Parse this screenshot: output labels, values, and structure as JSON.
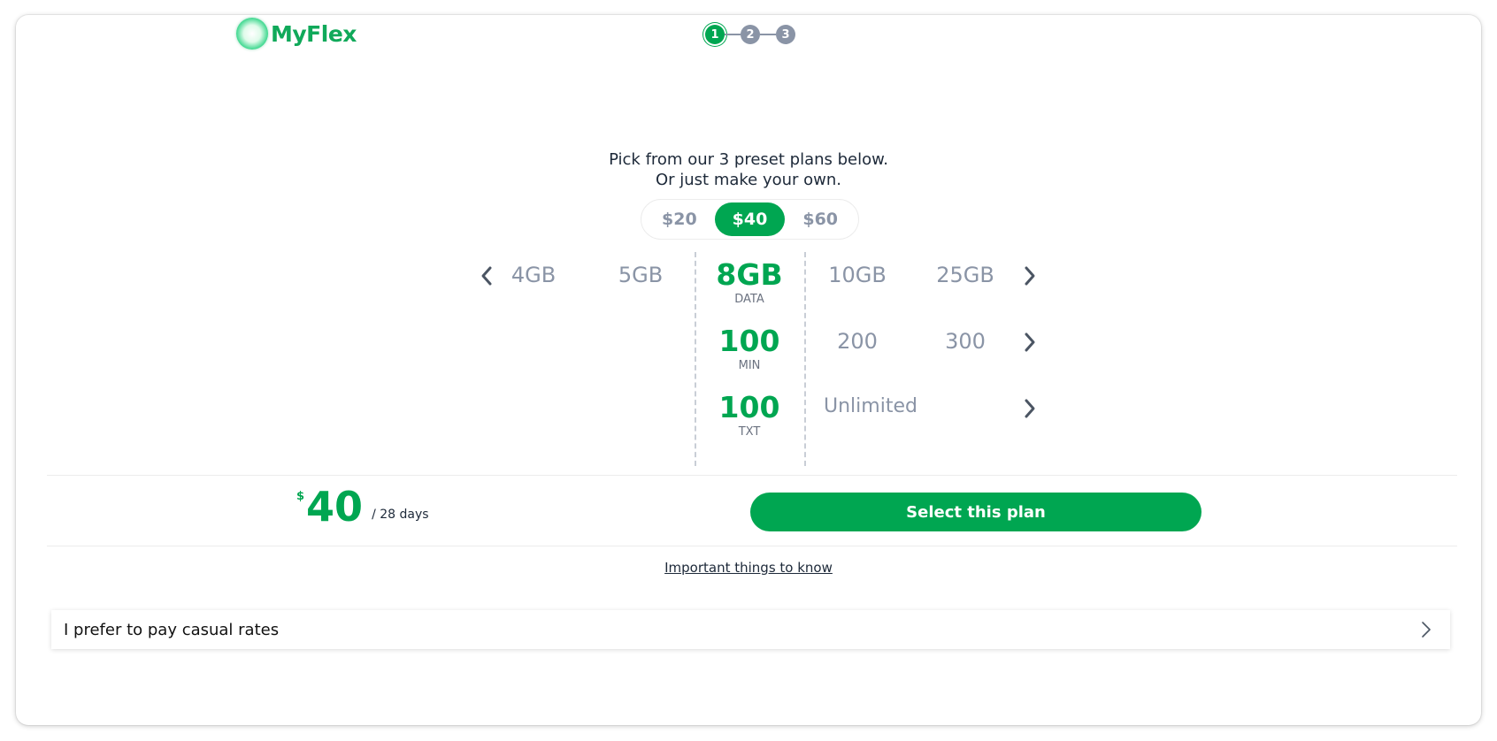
{
  "brand": {
    "name": "MyFlex"
  },
  "stepper": {
    "steps": [
      "1",
      "2",
      "3"
    ],
    "active": 1
  },
  "intro": {
    "line1": "Pick from our 3 preset plans below.",
    "line2": "Or just make your own."
  },
  "price_tabs": [
    {
      "label": "$20",
      "selected": false
    },
    {
      "label": "$40",
      "selected": true
    },
    {
      "label": "$60",
      "selected": false
    }
  ],
  "data_row": {
    "options": [
      "4GB",
      "5GB",
      "8GB",
      "10GB",
      "25GB"
    ],
    "selected": "8GB",
    "unit": "DATA"
  },
  "min_row": {
    "options": [
      "100",
      "200",
      "300"
    ],
    "selected": "100",
    "unit": "MIN"
  },
  "txt_row": {
    "options": [
      "100",
      "Unlimited"
    ],
    "selected": "100",
    "unit": "TXT"
  },
  "summary": {
    "currency": "$",
    "amount": "40",
    "period": "/ 28 days"
  },
  "select_button": {
    "label": "Select this plan"
  },
  "link": {
    "label": "Important things to know"
  },
  "casual": {
    "label": "I prefer to pay casual rates"
  },
  "colors": {
    "accent": "#00a651",
    "muted": "#8a94a6",
    "text": "#1d2939"
  },
  "icons": {
    "prev": "chevron-left-icon",
    "next": "chevron-right-icon"
  }
}
